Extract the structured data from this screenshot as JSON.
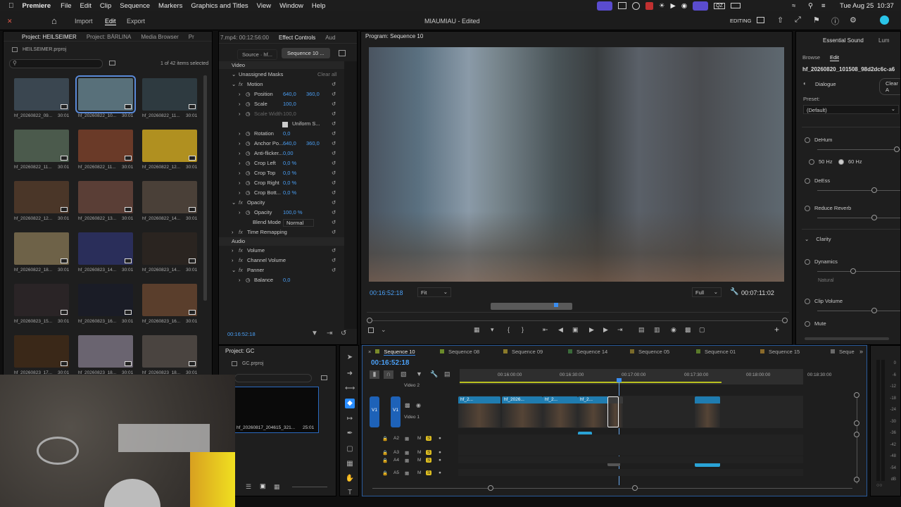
{
  "menubar": {
    "app": "Premiere",
    "items": [
      "File",
      "Edit",
      "Clip",
      "Sequence",
      "Markers",
      "Graphics and Titles",
      "View",
      "Window",
      "Help"
    ],
    "date": "Tue Aug 25",
    "time": "10:37"
  },
  "titlebar": {
    "tabs": [
      "Import",
      "Edit",
      "Export"
    ],
    "title": "MIAUMIAU - Edited",
    "workspace": "EDITING"
  },
  "project_panel": {
    "tabs": [
      "Project: HEILSEIMER",
      "Project: BÄRLINA",
      "Media Browser",
      "Pr"
    ],
    "file": "HEILSEIMER.prproj",
    "count": "1 of 42 items selected",
    "items": [
      {
        "name": "hf_20260822_09...",
        "dur": "30:01",
        "color": "#3a4650"
      },
      {
        "name": "hf_20260822_10...",
        "dur": "30:01",
        "color": "#58707a"
      },
      {
        "name": "hf_20260822_11...",
        "dur": "30:01",
        "color": "#2e3a40"
      },
      {
        "name": "hf_20260822_11...",
        "dur": "30:01",
        "color": "#4b5a4c"
      },
      {
        "name": "hf_20260822_11...",
        "dur": "30:01",
        "color": "#6a3a28"
      },
      {
        "name": "hf_20260822_12...",
        "dur": "30:01",
        "color": "#b09020"
      },
      {
        "name": "hf_20260822_12...",
        "dur": "30:01",
        "color": "#4a3628"
      },
      {
        "name": "hf_20260822_13...",
        "dur": "30:01",
        "color": "#5a3e36"
      },
      {
        "name": "hf_20260822_14...",
        "dur": "30:01",
        "color": "#4a4038"
      },
      {
        "name": "hf_20260822_18...",
        "dur": "30:01",
        "color": "#6e6248"
      },
      {
        "name": "hf_20260823_14...",
        "dur": "30:01",
        "color": "#2a2e5a"
      },
      {
        "name": "hf_20260823_14...",
        "dur": "30:01",
        "color": "#2a2420"
      },
      {
        "name": "hf_20260823_15...",
        "dur": "30:01",
        "color": "#2a2426"
      },
      {
        "name": "hf_20260823_16...",
        "dur": "30:01",
        "color": "#1a1c26"
      },
      {
        "name": "hf_20260823_16...",
        "dur": "30:01",
        "color": "#5a3e2c"
      },
      {
        "name": "hf_20260823_17...",
        "dur": "30:01",
        "color": "#3a2818"
      },
      {
        "name": "hf_20260823_18...",
        "dur": "30:01",
        "color": "#6a6470"
      },
      {
        "name": "hf_20260823_18...",
        "dur": "30:01",
        "color": "#4a4440"
      }
    ]
  },
  "effect_controls": {
    "tabs": [
      "7.mp4: 00:12:56:00",
      "Effect Controls",
      "Aud"
    ],
    "source_tab": "Source · hf...",
    "seq_tab": "Sequence 10 ...",
    "video_header": "Video",
    "masks": "Unassigned Masks",
    "clear": "Clear all",
    "rows": [
      {
        "label": "Motion",
        "fx": true,
        "indent": 1
      },
      {
        "label": "Position",
        "v1": "640,0",
        "v2": "360,0",
        "indent": 2
      },
      {
        "label": "Scale",
        "v1": "100,0",
        "indent": 2
      },
      {
        "label": "Scale Width",
        "v1": "100,0",
        "indent": 2,
        "dim": true
      },
      {
        "label": "Uniform S...",
        "indent": 3,
        "check": true
      },
      {
        "label": "Rotation",
        "v1": "0,0",
        "indent": 2
      },
      {
        "label": "Anchor Po...",
        "v1": "640,0",
        "v2": "360,0",
        "indent": 2
      },
      {
        "label": "Anti-flicker...",
        "v1": "0,00",
        "indent": 2
      },
      {
        "label": "Crop Left",
        "v1": "0,0 %",
        "indent": 2
      },
      {
        "label": "Crop Top",
        "v1": "0,0 %",
        "indent": 2
      },
      {
        "label": "Crop Right",
        "v1": "0,0 %",
        "indent": 2
      },
      {
        "label": "Crop Bott...",
        "v1": "0,0 %",
        "indent": 2
      },
      {
        "label": "Opacity",
        "fx": true,
        "indent": 1
      },
      {
        "label": "Opacity",
        "v1": "100,0 %",
        "indent": 2
      },
      {
        "label": "Blend Mode",
        "v1": "Normal",
        "indent": 2,
        "select": true
      },
      {
        "label": "Time Remapping",
        "fx": true,
        "indent": 1
      }
    ],
    "audio_header": "Audio",
    "audio_rows": [
      {
        "label": "Volume"
      },
      {
        "label": "Channel Volume"
      },
      {
        "label": "Panner"
      },
      {
        "label": "Balance",
        "v1": "0,0"
      }
    ],
    "timecode": "00:16:52:18"
  },
  "program": {
    "title": "Program: Sequence 10",
    "timecode": "00:16:52:18",
    "fit": "Fit",
    "full": "Full",
    "duration": "00:07:11:02"
  },
  "essential_sound": {
    "title": "Essential Sound",
    "tabs": [
      "Browse",
      "Edit"
    ],
    "clip": "hf_20260820_101508_98d2dc6c-a6",
    "type": "Dialogue",
    "clear": "Clear A",
    "preset_label": "Preset:",
    "preset": "(Default)",
    "rows": [
      "DeHum",
      "DeEss",
      "Reduce Reverb"
    ],
    "hz": [
      "50 Hz",
      "60 Hz"
    ],
    "clarity": "Clarity",
    "dynamics": "Dynamics",
    "natural": "Natural",
    "clip_volume": "Clip Volume",
    "mute": "Mute",
    "lum": "Lum"
  },
  "project_gc": {
    "title": "Project: GC",
    "file": "GC.prproj",
    "item_name": "hf_20260817_204615_321...",
    "item_dur": "25:01"
  },
  "timeline": {
    "timecode": "00:16:52:18",
    "tabs": [
      "Sequence 10",
      "Sequence 08",
      "Sequence 09",
      "Sequence 14",
      "Sequence 05",
      "Sequence 01",
      "Sequence 15",
      "Seque"
    ],
    "tab_colors": [
      "#7a8a2a",
      "#6a8a2a",
      "#8a7a2a",
      "#3a6a3a",
      "#7a6a2a",
      "#5a7a2a",
      "#8a6a2a",
      "#6a6a6a"
    ],
    "ruler": [
      "00:16:00:00",
      "00:16:30:00",
      "00:17:00:00",
      "00:17:30:00",
      "00:18:00:00",
      "00:18:30:00"
    ],
    "tracks": {
      "v2": "Video 2",
      "v1": "Video 1",
      "a2": "A2",
      "a3": "A3",
      "a4": "A4",
      "a5": "A5",
      "v1src": "V1",
      "v1tgt": "V1"
    },
    "clip_labels": [
      "hf_2...",
      "hf_2026...",
      "hf_2...",
      "hf_2..."
    ],
    "meter": [
      "0",
      "-6",
      "-12",
      "-18",
      "-24",
      "-30",
      "-36",
      "-42",
      "-48",
      "-54",
      "dB"
    ],
    "mute": "M",
    "solo": "S"
  },
  "colors": {
    "accent": "#2a8dff",
    "panel": "#1e1e1e",
    "clip_video": "#1f7cb0",
    "clip_audio": "#2aa3d6"
  }
}
